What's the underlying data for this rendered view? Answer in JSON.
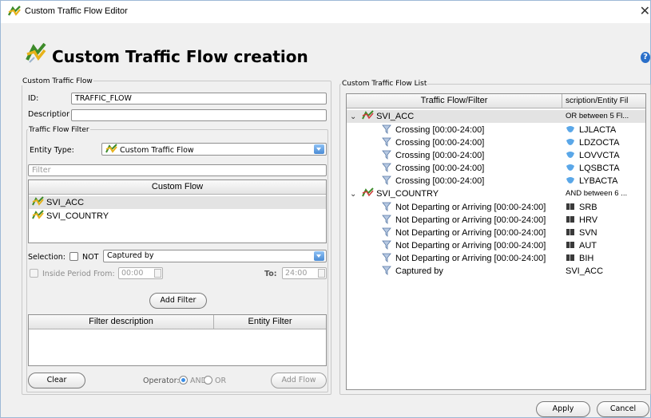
{
  "window": {
    "title": "Custom Traffic Flow Editor",
    "close_glyph": "✕"
  },
  "header": {
    "title": "Custom Traffic Flow creation",
    "help_glyph": "?"
  },
  "left": {
    "legend": "Custom Traffic Flow",
    "id_label": "ID:",
    "id_value": "TRAFFIC_FLOW",
    "description_label": "Descriptior",
    "description_value": "",
    "filter_legend": "Traffic Flow Filter",
    "entity_type_label": "Entity Type:",
    "entity_type_value": "Custom Traffic Flow",
    "filter_placeholder": "Filter",
    "flow_list": {
      "header": "Custom Flow",
      "items": [
        {
          "label": "SVI_ACC",
          "selected": true
        },
        {
          "label": "SVI_COUNTRY",
          "selected": false
        }
      ]
    },
    "selection_label": "Selection:",
    "not_label": "NOT",
    "selection_value": "Captured by",
    "inside_period_label": "Inside Period From:",
    "from_value": "00:00",
    "to_label": "To:",
    "to_value": "24:00",
    "add_filter_label": "Add Filter",
    "filter_table": {
      "col1": "Filter description",
      "col2": "Entity Filter"
    },
    "clear_label": "Clear",
    "operator_label": "Operator:",
    "and_label": "AND",
    "or_label": "OR",
    "operator_selected": "AND",
    "add_flow_label": "Add Flow"
  },
  "right": {
    "legend": "Custom Traffic Flow List",
    "col1": "Traffic Flow/Filter",
    "col2": "scription/Entity Fil",
    "groups": [
      {
        "name": "SVI_ACC",
        "summary": "OR between 5 Fl...",
        "selected": true,
        "children": [
          {
            "label": "Crossing [00:00-24:00]",
            "entity": "LJLACTA",
            "entity_icon": "airspace-icon"
          },
          {
            "label": "Crossing [00:00-24:00]",
            "entity": "LDZOCTA",
            "entity_icon": "airspace-icon"
          },
          {
            "label": "Crossing [00:00-24:00]",
            "entity": "LOVVCTA",
            "entity_icon": "airspace-icon"
          },
          {
            "label": "Crossing [00:00-24:00]",
            "entity": "LQSBCTA",
            "entity_icon": "airspace-icon"
          },
          {
            "label": "Crossing [00:00-24:00]",
            "entity": "LYBACTA",
            "entity_icon": "airspace-icon"
          }
        ]
      },
      {
        "name": "SVI_COUNTRY",
        "summary": "AND between 6 ...",
        "selected": false,
        "children": [
          {
            "label": "Not Departing or Arriving [00:00-24:00]",
            "entity": "SRB",
            "entity_icon": "country-flag-icon"
          },
          {
            "label": "Not Departing or Arriving [00:00-24:00]",
            "entity": "HRV",
            "entity_icon": "country-flag-icon"
          },
          {
            "label": "Not Departing or Arriving [00:00-24:00]",
            "entity": "SVN",
            "entity_icon": "country-flag-icon"
          },
          {
            "label": "Not Departing or Arriving [00:00-24:00]",
            "entity": "AUT",
            "entity_icon": "country-flag-icon"
          },
          {
            "label": "Not Departing or Arriving [00:00-24:00]",
            "entity": "BIH",
            "entity_icon": "country-flag-icon"
          },
          {
            "label": "Captured by",
            "entity": "SVI_ACC",
            "entity_icon": ""
          }
        ]
      }
    ]
  },
  "footer": {
    "apply_label": "Apply",
    "cancel_label": "Cancel"
  },
  "colors": {
    "accent": "#3b8ee6",
    "selection_row": "#e3e3e3",
    "window_bg": "#f0f0f0"
  }
}
